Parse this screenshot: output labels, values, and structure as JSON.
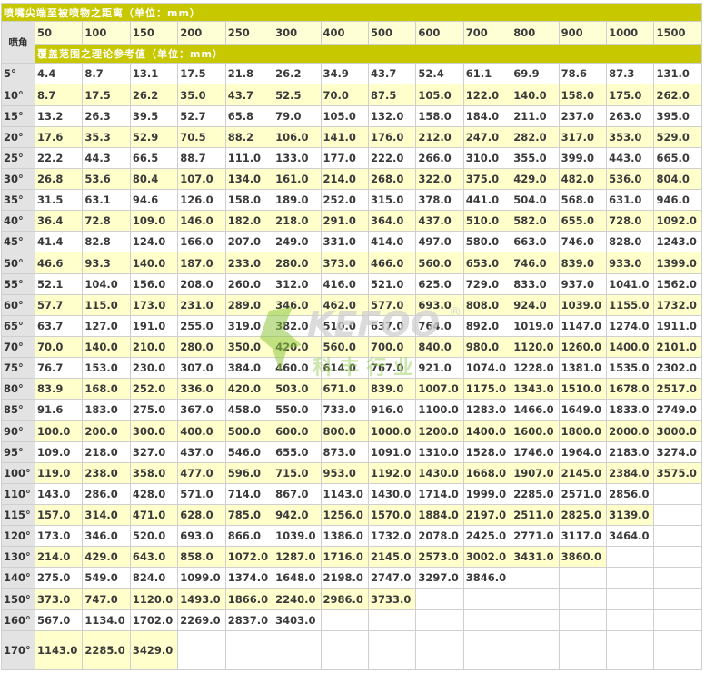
{
  "title": "喷嘴尖端至被喷物之距离（单位：mm）",
  "corner_label": "喷角",
  "distances": [
    "50",
    "100",
    "150",
    "200",
    "250",
    "300",
    "400",
    "500",
    "600",
    "700",
    "800",
    "900",
    "1000",
    "1500"
  ],
  "coverage_title": "覆盖范围之理论参考值（单位：mm）",
  "watermark": {
    "brand": "KEFOO",
    "mark": "®",
    "chinese": "科 丰 行 业"
  },
  "rows": [
    {
      "angle": "5°",
      "values": [
        "4.4",
        "8.7",
        "13.1",
        "17.5",
        "21.8",
        "26.2",
        "34.9",
        "43.7",
        "52.4",
        "61.1",
        "69.9",
        "78.6",
        "87.3",
        "131.0"
      ]
    },
    {
      "angle": "10°",
      "values": [
        "8.7",
        "17.5",
        "26.2",
        "35.0",
        "43.7",
        "52.5",
        "70.0",
        "87.5",
        "105.0",
        "122.0",
        "140.0",
        "158.0",
        "175.0",
        "262.0"
      ]
    },
    {
      "angle": "15°",
      "values": [
        "13.2",
        "26.3",
        "39.5",
        "52.7",
        "65.8",
        "79.0",
        "105.0",
        "132.0",
        "158.0",
        "184.0",
        "211.0",
        "237.0",
        "263.0",
        "395.0"
      ]
    },
    {
      "angle": "20°",
      "values": [
        "17.6",
        "35.3",
        "52.9",
        "70.5",
        "88.2",
        "106.0",
        "141.0",
        "176.0",
        "212.0",
        "247.0",
        "282.0",
        "317.0",
        "353.0",
        "529.0"
      ]
    },
    {
      "angle": "25°",
      "values": [
        "22.2",
        "44.3",
        "66.5",
        "88.7",
        "111.0",
        "133.0",
        "177.0",
        "222.0",
        "266.0",
        "310.0",
        "355.0",
        "399.0",
        "443.0",
        "665.0"
      ]
    },
    {
      "angle": "30°",
      "values": [
        "26.8",
        "53.6",
        "80.4",
        "107.0",
        "134.0",
        "161.0",
        "214.0",
        "268.0",
        "322.0",
        "375.0",
        "429.0",
        "482.0",
        "536.0",
        "804.0"
      ]
    },
    {
      "angle": "35°",
      "values": [
        "31.5",
        "63.1",
        "94.6",
        "126.0",
        "158.0",
        "189.0",
        "252.0",
        "315.0",
        "378.0",
        "441.0",
        "504.0",
        "568.0",
        "631.0",
        "946.0"
      ]
    },
    {
      "angle": "40°",
      "values": [
        "36.4",
        "72.8",
        "109.0",
        "146.0",
        "182.0",
        "218.0",
        "291.0",
        "364.0",
        "437.0",
        "510.0",
        "582.0",
        "655.0",
        "728.0",
        "1092.0"
      ]
    },
    {
      "angle": "45°",
      "values": [
        "41.4",
        "82.8",
        "124.0",
        "166.0",
        "207.0",
        "249.0",
        "331.0",
        "414.0",
        "497.0",
        "580.0",
        "663.0",
        "746.0",
        "828.0",
        "1243.0"
      ]
    },
    {
      "angle": "50°",
      "values": [
        "46.6",
        "93.3",
        "140.0",
        "187.0",
        "233.0",
        "280.0",
        "373.0",
        "466.0",
        "560.0",
        "653.0",
        "746.0",
        "839.0",
        "933.0",
        "1399.0"
      ]
    },
    {
      "angle": "55°",
      "values": [
        "52.1",
        "104.0",
        "156.0",
        "208.0",
        "260.0",
        "312.0",
        "416.0",
        "521.0",
        "625.0",
        "729.0",
        "833.0",
        "937.0",
        "1041.0",
        "1562.0"
      ]
    },
    {
      "angle": "60°",
      "values": [
        "57.7",
        "115.0",
        "173.0",
        "231.0",
        "289.0",
        "346.0",
        "462.0",
        "577.0",
        "693.0",
        "808.0",
        "924.0",
        "1039.0",
        "1155.0",
        "1732.0"
      ]
    },
    {
      "angle": "65°",
      "values": [
        "63.7",
        "127.0",
        "191.0",
        "255.0",
        "319.0",
        "382.0",
        "510.0",
        "637.0",
        "764.0",
        "892.0",
        "1019.0",
        "1147.0",
        "1274.0",
        "1911.0"
      ]
    },
    {
      "angle": "70°",
      "values": [
        "70.0",
        "140.0",
        "210.0",
        "280.0",
        "350.0",
        "420.0",
        "560.0",
        "700.0",
        "840.0",
        "980.0",
        "1120.0",
        "1260.0",
        "1400.0",
        "2101.0"
      ]
    },
    {
      "angle": "75°",
      "values": [
        "76.7",
        "153.0",
        "230.0",
        "307.0",
        "384.0",
        "460.0",
        "614.0",
        "767.0",
        "921.0",
        "1074.0",
        "1228.0",
        "1381.0",
        "1535.0",
        "2302.0"
      ]
    },
    {
      "angle": "80°",
      "values": [
        "83.9",
        "168.0",
        "252.0",
        "336.0",
        "420.0",
        "503.0",
        "671.0",
        "839.0",
        "1007.0",
        "1175.0",
        "1343.0",
        "1510.0",
        "1678.0",
        "2517.0"
      ]
    },
    {
      "angle": "85°",
      "values": [
        "91.6",
        "183.0",
        "275.0",
        "367.0",
        "458.0",
        "550.0",
        "733.0",
        "916.0",
        "1100.0",
        "1283.0",
        "1466.0",
        "1649.0",
        "1833.0",
        "2749.0"
      ]
    },
    {
      "angle": "90°",
      "values": [
        "100.0",
        "200.0",
        "300.0",
        "400.0",
        "500.0",
        "600.0",
        "800.0",
        "1000.0",
        "1200.0",
        "1400.0",
        "1600.0",
        "1800.0",
        "2000.0",
        "3000.0"
      ]
    },
    {
      "angle": "95°",
      "values": [
        "109.0",
        "218.0",
        "327.0",
        "437.0",
        "546.0",
        "655.0",
        "873.0",
        "1091.0",
        "1310.0",
        "1528.0",
        "1746.0",
        "1964.0",
        "2183.0",
        "3274.0"
      ]
    },
    {
      "angle": "100°",
      "values": [
        "119.0",
        "238.0",
        "358.0",
        "477.0",
        "596.0",
        "715.0",
        "953.0",
        "1192.0",
        "1430.0",
        "1668.0",
        "1907.0",
        "2145.0",
        "2384.0",
        "3575.0"
      ]
    },
    {
      "angle": "110°",
      "values": [
        "143.0",
        "286.0",
        "428.0",
        "571.0",
        "714.0",
        "867.0",
        "1143.0",
        "1430.0",
        "1714.0",
        "1999.0",
        "2285.0",
        "2571.0",
        "2856.0",
        ""
      ]
    },
    {
      "angle": "115°",
      "values": [
        "157.0",
        "314.0",
        "471.0",
        "628.0",
        "785.0",
        "942.0",
        "1256.0",
        "1570.0",
        "1884.0",
        "2197.0",
        "2511.0",
        "2825.0",
        "3139.0",
        ""
      ]
    },
    {
      "angle": "120°",
      "values": [
        "173.0",
        "346.0",
        "520.0",
        "693.0",
        "866.0",
        "1039.0",
        "1386.0",
        "1732.0",
        "2078.0",
        "2425.0",
        "2771.0",
        "3117.0",
        "3464.0",
        ""
      ]
    },
    {
      "angle": "130°",
      "values": [
        "214.0",
        "429.0",
        "643.0",
        "858.0",
        "1072.0",
        "1287.0",
        "1716.0",
        "2145.0",
        "2573.0",
        "3002.0",
        "3431.0",
        "3860.0",
        "",
        ""
      ]
    },
    {
      "angle": "140°",
      "values": [
        "275.0",
        "549.0",
        "824.0",
        "1099.0",
        "1374.0",
        "1648.0",
        "2198.0",
        "2747.0",
        "3297.0",
        "3846.0",
        "",
        "",
        "",
        ""
      ]
    },
    {
      "angle": "150°",
      "values": [
        "373.0",
        "747.0",
        "1120.0",
        "1493.0",
        "1866.0",
        "2240.0",
        "2986.0",
        "3733.0",
        "",
        "",
        "",
        "",
        "",
        ""
      ]
    },
    {
      "angle": "160°",
      "values": [
        "567.0",
        "1134.0",
        "1702.0",
        "2269.0",
        "2837.0",
        "3403.0",
        "",
        "",
        "",
        "",
        "",
        "",
        "",
        ""
      ]
    },
    {
      "angle": "170°",
      "values": [
        "1143.0",
        "2285.0",
        "3429.0",
        "",
        "",
        "",
        "",
        "",
        "",
        "",
        "",
        "",
        "",
        ""
      ]
    }
  ]
}
